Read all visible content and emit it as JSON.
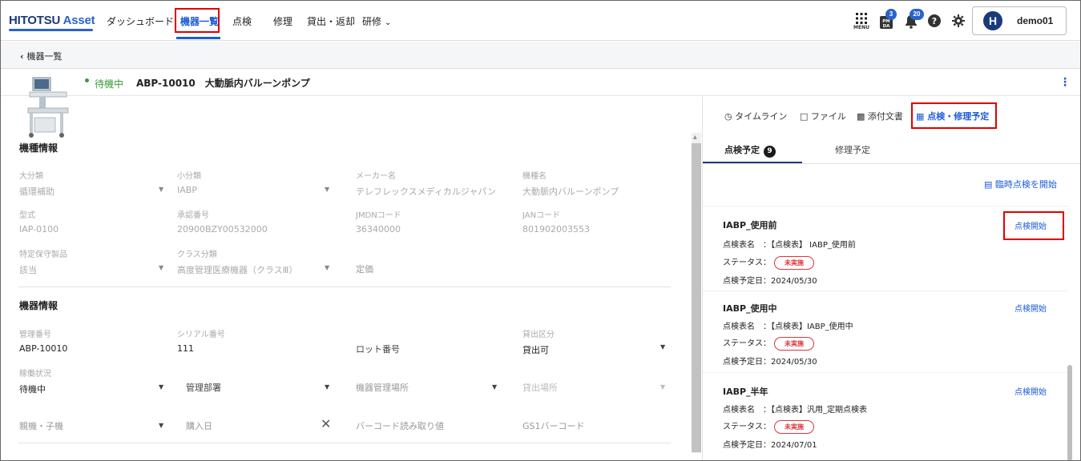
{
  "nav": {
    "logo_main": "HITOTSU",
    "logo_asset": "Asset",
    "items": [
      "ダッシュボード",
      "機器一覧",
      "点検",
      "修理",
      "貸出・返却",
      "研修"
    ],
    "active": "機器一覧",
    "menu_label": "MENU",
    "notification_badge_pm": "3",
    "notification_badge_bell": "20",
    "user_initial": "H",
    "username": "demo01"
  },
  "back": {
    "label": "機器一覧"
  },
  "device": {
    "status": "待機中",
    "title": "ABP-10010　大動脈内バルーンポンプ",
    "status_color": "#3a9a3a"
  },
  "model_info": {
    "section": "機種情報",
    "fields": [
      {
        "label": "大分類",
        "value": "循環補助"
      },
      {
        "label": "小分類",
        "value": "IABP"
      },
      {
        "label": "メーカー名",
        "value": "テレフレックスメディカルジャパン"
      },
      {
        "label": "機種名",
        "value": "大動脈内バルーンポンプ"
      },
      {
        "label": "型式",
        "value": "IAP-0100"
      },
      {
        "label": "承認番号",
        "value": "20900BZY00532000"
      },
      {
        "label": "JMDNコード",
        "value": "36340000"
      },
      {
        "label": "JANコード",
        "value": "801902003553"
      },
      {
        "label": "特定保守製品",
        "value": "該当"
      },
      {
        "label": "クラス分類",
        "value": "高度管理医療機器（クラスⅢ）"
      }
    ],
    "price_placeholder": "定価"
  },
  "device_info": {
    "section": "機器情報",
    "mgmt_label": "管理番号",
    "mgmt_value": "ABP-10010",
    "serial_label": "シリアル番号",
    "serial_value": "111",
    "lot_placeholder": "ロット番号",
    "loan_label": "貸出区分",
    "loan_value": "貸出可",
    "op_label": "稼働状況",
    "op_value": "待機中",
    "dept_placeholder": "管理部署",
    "location_placeholder": "機器管理場所",
    "loan_place_placeholder": "貸出場所",
    "parent_placeholder": "親機・子機",
    "purchase_placeholder": "購入日",
    "barcode_placeholder": "バーコード読み取り値",
    "gs1_placeholder": "GS1バーコード"
  },
  "right": {
    "tabs": [
      "タイムライン",
      "ファイル",
      "添付文書",
      "点検・修理予定"
    ],
    "active_tab": "点検・修理予定",
    "subtabs": [
      {
        "label": "点検予定",
        "count": "9"
      },
      {
        "label": "修理予定"
      }
    ],
    "adhoc": "臨時点検を開始",
    "start_label": "点検開始",
    "table_label": "点検表名",
    "status_label": "ステータス",
    "date_label": "点検予定日",
    "status_pill": "未実施",
    "cards": [
      {
        "title": "IABP_使用前",
        "table": "：【点検表】 IABP_使用前",
        "date": "：2024/05/30"
      },
      {
        "title": "IABP_使用中",
        "table": "：【点検表】IABP_使用中",
        "date": "：2024/05/30"
      },
      {
        "title": "IABP_半年",
        "table": "：【点検表】汎用_定期点検表",
        "date": "：2024/07/01"
      }
    ]
  }
}
